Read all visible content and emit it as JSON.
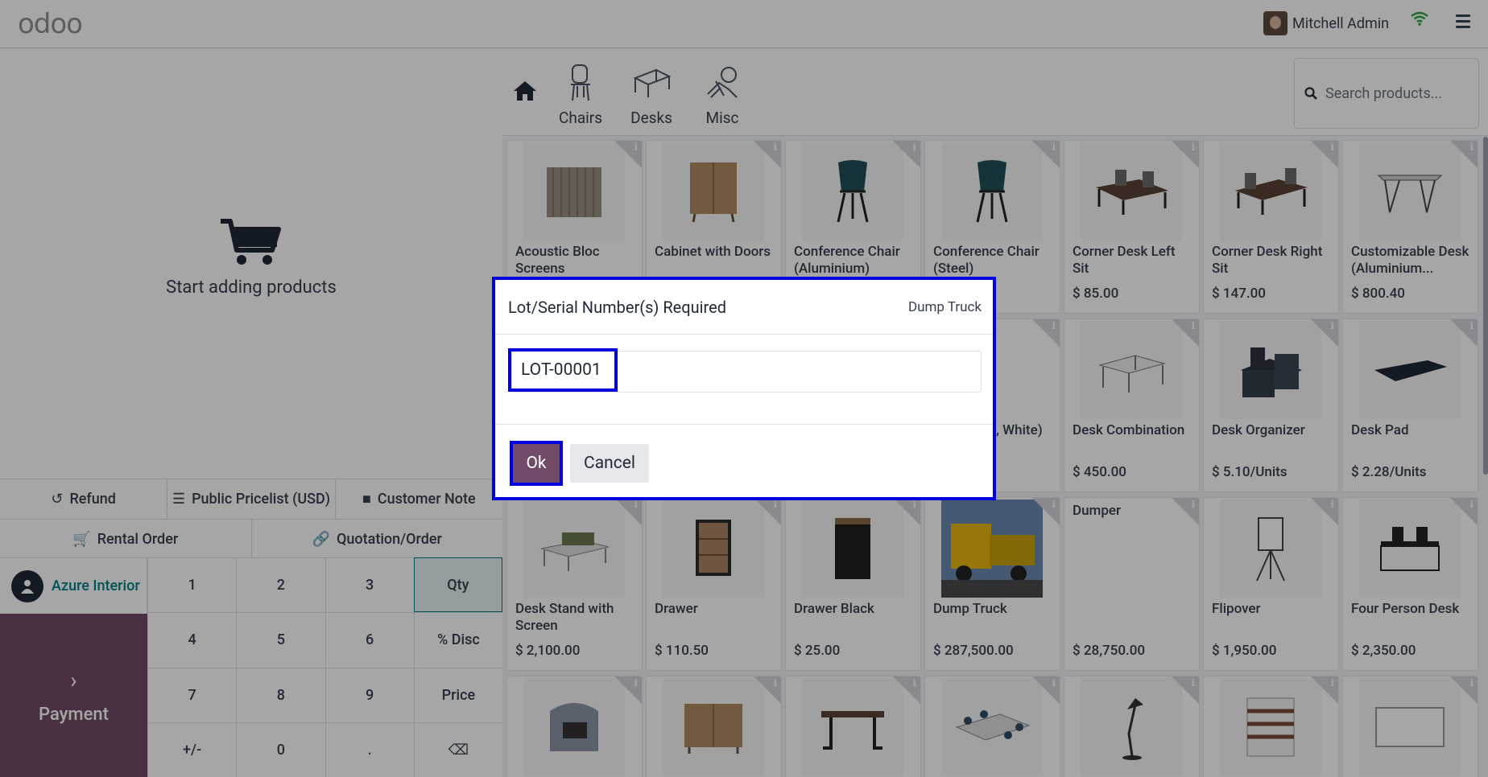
{
  "app": {
    "logo": "odoo",
    "user_name": "Mitchell Admin"
  },
  "cart": {
    "empty_text": "Start adding products"
  },
  "controls": {
    "refund": "Refund",
    "pricelist": "Public Pricelist (USD)",
    "customer_note": "Customer Note",
    "rental_order": "Rental Order",
    "quotation": "Quotation/Order"
  },
  "customer": {
    "name": "Azure Interior"
  },
  "payment": {
    "label": "Payment",
    "chevron": "›"
  },
  "numpad": [
    "1",
    "2",
    "3",
    "Qty",
    "4",
    "5",
    "6",
    "% Disc",
    "7",
    "8",
    "9",
    "Price",
    "+/-",
    "0",
    ".",
    "⌫"
  ],
  "categories": [
    {
      "label": "Chairs",
      "icon": "chair-icon"
    },
    {
      "label": "Desks",
      "icon": "desk-icon"
    },
    {
      "label": "Misc",
      "icon": "misc-icon"
    }
  ],
  "search": {
    "placeholder": "Search products..."
  },
  "products": [
    {
      "name": "Acoustic Bloc Screens",
      "price": ""
    },
    {
      "name": "Cabinet with Doors",
      "price": ""
    },
    {
      "name": "Conference Chair (Aluminium)",
      "price": ""
    },
    {
      "name": "Conference Chair (Steel)",
      "price": ""
    },
    {
      "name": "Corner Desk Left Sit",
      "price": "$ 85.00"
    },
    {
      "name": "Corner Desk Right Sit",
      "price": "$ 147.00"
    },
    {
      "name": "Customizable Desk (Aluminium...",
      "price": "$ 800.40"
    },
    {
      "name": "",
      "price": ""
    },
    {
      "name": "",
      "price": ""
    },
    {
      "name": "",
      "price": ""
    },
    {
      "name": "...able ...el, White)",
      "price": ""
    },
    {
      "name": "Desk Combination",
      "price": "$ 450.00"
    },
    {
      "name": "Desk Organizer",
      "price": "$ 5.10/Units"
    },
    {
      "name": "Desk Pad",
      "price": "$ 2.28/Units"
    },
    {
      "name": "Desk Stand with Screen",
      "price": "$ 2,100.00"
    },
    {
      "name": "Drawer",
      "price": "$ 110.50"
    },
    {
      "name": "Drawer Black",
      "price": "$ 25.00"
    },
    {
      "name": "Dump Truck",
      "price": "$ 287,500.00"
    },
    {
      "name": "Dumper",
      "price": "$ 28,750.00"
    },
    {
      "name": "Flipover",
      "price": "$ 1,950.00"
    },
    {
      "name": "Four Person Desk",
      "price": "$ 2,350.00"
    },
    {
      "name": "",
      "price": ""
    },
    {
      "name": "",
      "price": ""
    },
    {
      "name": "",
      "price": ""
    },
    {
      "name": "",
      "price": ""
    },
    {
      "name": "",
      "price": ""
    },
    {
      "name": "",
      "price": ""
    },
    {
      "name": "",
      "price": ""
    }
  ],
  "dialog": {
    "title": "Lot/Serial Number(s) Required",
    "product": "Dump Truck",
    "lot_value": "LOT-00001",
    "ok": "Ok",
    "cancel": "Cancel"
  },
  "colors": {
    "primary": "#714b67",
    "accent": "#017e84",
    "highlight": "#0000e0"
  }
}
